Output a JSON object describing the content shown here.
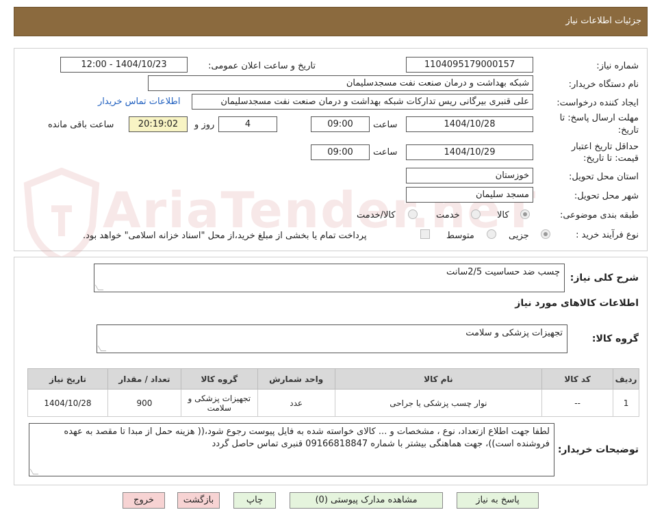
{
  "header": {
    "title": "جزئیات اطلاعات نیاز"
  },
  "form": {
    "need_number_label": "شماره نیاز:",
    "need_number": "1104095179000157",
    "announce_label": "تاریخ و ساعت اعلان عمومی:",
    "announce_value": "1404/10/23 - 12:00",
    "buyer_org_label": "نام دستگاه خریدار:",
    "buyer_org": "شبکه بهداشت و درمان صنعت نفت مسجدسلیمان",
    "requester_label": "ایجاد کننده درخواست:",
    "requester": "علی قنبری بیرگانی ریس تدارکات شبکه بهداشت و درمان صنعت نفت مسجدسلیمان",
    "contact_link": "اطلاعات تماس خریدار",
    "deadline_label_1": "مهلت ارسال پاسخ: تا",
    "deadline_label_2": "تاریخ:",
    "deadline_date": "1404/10/28",
    "time_label": "ساعت",
    "deadline_time": "09:00",
    "days_value": "4",
    "days_label": "روز و",
    "remaining_time": "20:19:02",
    "remaining_label": "ساعت باقی مانده",
    "validity_label_1": "حداقل تاریخ اعتبار",
    "validity_label_2": "قیمت: تا تاریخ:",
    "validity_date": "1404/10/29",
    "validity_time_label": "ساعت",
    "validity_time": "09:00",
    "province_label": "استان محل تحویل:",
    "province": "خوزستان",
    "city_label": "شهر محل تحویل:",
    "city": "مسجد سلیمان",
    "category_label": "طبقه بندی موضوعی:",
    "category_options": [
      "کالا",
      "خدمت",
      "کالا/خدمت"
    ],
    "process_label": "نوع فرآیند خرید :",
    "process_options": [
      "جزیی",
      "متوسط"
    ],
    "payment_note": "پرداخت تمام یا بخشی از مبلغ خرید،از محل \"اسناد خزانه اسلامی\" خواهد بود."
  },
  "details": {
    "summary_label": "شرح کلی نیاز:",
    "summary": "چسب ضد حساسیت 2/5سانت",
    "goods_info_title": "اطلاعات کالاهای مورد نیاز",
    "goods_group_label": "گروه کالا:",
    "goods_group": "تجهیزات پزشکی و سلامت",
    "table": {
      "headers": [
        "ردیف",
        "کد کالا",
        "نام کالا",
        "واحد شمارش",
        "گروه کالا",
        "تعداد / مقدار",
        "تاریخ نیاز"
      ],
      "rows": [
        [
          "1",
          "--",
          "نوار چسب پزشکی یا جراحی",
          "عدد",
          "تجهیزات پزشکی و سلامت",
          "900",
          "1404/10/28"
        ]
      ]
    },
    "buyer_notes_label": "توضیحات خریدار:",
    "buyer_notes": "لطفا جهت اطلاع ازتعداد،  نوع ، مشخصات و ... کالای خواسته شده به فایل پیوست رجوع شود،(( هزینه حمل از مبدا تا مقصد به عهده فروشنده است))، جهت هماهنگی بیشتر با شماره 09166818847 قنبری تماس حاصل گردد"
  },
  "buttons": {
    "reply": "پاسخ به نیاز",
    "attachments": "مشاهده مدارک پیوستی (0)",
    "print": "چاپ",
    "back": "بازگشت",
    "exit": "خروج"
  },
  "watermark": {
    "text": "AriaTender.neT"
  }
}
